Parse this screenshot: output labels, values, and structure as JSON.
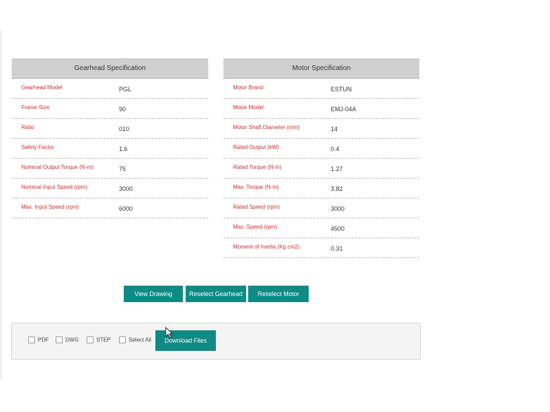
{
  "gearhead": {
    "title": "Gearhead Specification",
    "rows": [
      {
        "label": "Gearhead Model",
        "value": "PGL"
      },
      {
        "label": "Frame Size",
        "value": "90"
      },
      {
        "label": "Ratio",
        "value": "010"
      },
      {
        "label": "Safety Factor",
        "value": "1.6"
      },
      {
        "label": "Nominal Output Torque (N-m)",
        "value": "75"
      },
      {
        "label": "Nominal Input Speed (rpm)",
        "value": "3000"
      },
      {
        "label": "Max. Input Speed (rpm)",
        "value": "6000"
      }
    ]
  },
  "motor": {
    "title": "Motor Specification",
    "rows": [
      {
        "label": "Motor Brand",
        "value": "ESTUN"
      },
      {
        "label": "Motor Model",
        "value": "EMJ-04A"
      },
      {
        "label": "Motor Shaft Diameter (mm)",
        "value": "14"
      },
      {
        "label": "Rated Output (kW)",
        "value": "0.4"
      },
      {
        "label": "Rated Torque (N-m)",
        "value": "1.27"
      },
      {
        "label": "Max. Torque (N-m)",
        "value": "3.82"
      },
      {
        "label": "Rated Speed (rpm)",
        "value": "3000"
      },
      {
        "label": "Max. Speed (rpm)",
        "value": "4500"
      },
      {
        "label": "Moment of Inertia (Kg cm2)",
        "value": "0.31"
      }
    ]
  },
  "actions": {
    "view_drawing": "View Drawing",
    "reselect_gearhead": "Reselect Gearhead",
    "reselect_motor": "Reselect Motor"
  },
  "download": {
    "options": [
      {
        "label": "PDF",
        "checked": false
      },
      {
        "label": "DWG",
        "checked": false
      },
      {
        "label": "STEP",
        "checked": false
      },
      {
        "label": "Select All",
        "checked": false
      }
    ],
    "button_label": "Download Files"
  },
  "colors": {
    "accent": "#0f8a84",
    "label_red": "#cc2b2b",
    "header_gray": "#d0d0d0"
  }
}
